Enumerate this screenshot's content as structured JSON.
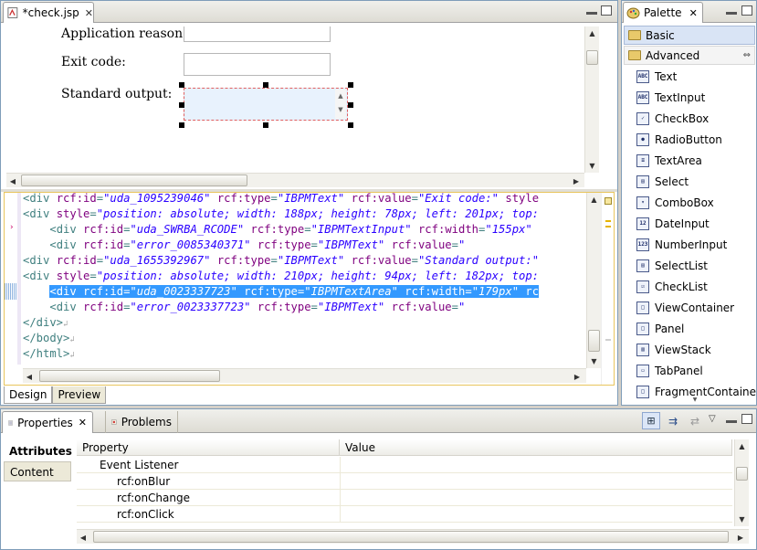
{
  "editor": {
    "tab_title": "*check.jsp",
    "design_form": {
      "labels": [
        "Application reason:",
        "Exit code:",
        "Standard output:"
      ]
    },
    "source_lines": [
      {
        "indent": "",
        "parts": [
          [
            "tag",
            "<div "
          ],
          [
            "attr",
            "rcf:id"
          ],
          [
            "tag",
            "="
          ],
          [
            "val",
            "\"uda_1095239046\""
          ],
          [
            "tag",
            " "
          ],
          [
            "attr",
            "rcf:type"
          ],
          [
            "tag",
            "="
          ],
          [
            "val",
            "\"IBPMText\""
          ],
          [
            "tag",
            " "
          ],
          [
            "attr",
            "rcf:value"
          ],
          [
            "tag",
            "="
          ],
          [
            "val",
            "\"Exit code:\""
          ],
          [
            "tag",
            " "
          ],
          [
            "attr",
            "style"
          ]
        ]
      },
      {
        "indent": "",
        "parts": [
          [
            "tag",
            "<div "
          ],
          [
            "attr",
            "style"
          ],
          [
            "tag",
            "="
          ],
          [
            "val",
            "\"position: absolute; width: 188px; height: 78px; left: 201px; top:"
          ]
        ]
      },
      {
        "indent": "    ",
        "parts": [
          [
            "tag",
            "<div "
          ],
          [
            "attr",
            "rcf:id"
          ],
          [
            "tag",
            "="
          ],
          [
            "val",
            "\"uda_SWRBA_RCODE\""
          ],
          [
            "tag",
            " "
          ],
          [
            "attr",
            "rcf:type"
          ],
          [
            "tag",
            "="
          ],
          [
            "val",
            "\"IBPMTextInput\""
          ],
          [
            "tag",
            " "
          ],
          [
            "attr",
            "rcf:width"
          ],
          [
            "tag",
            "="
          ],
          [
            "val",
            "\"155px\""
          ]
        ]
      },
      {
        "indent": "    ",
        "parts": [
          [
            "tag",
            "<div "
          ],
          [
            "attr",
            "rcf:id"
          ],
          [
            "tag",
            "="
          ],
          [
            "val",
            "\"error_0085340371\""
          ],
          [
            "tag",
            " "
          ],
          [
            "attr",
            "rcf:type"
          ],
          [
            "tag",
            "="
          ],
          [
            "val",
            "\"IBPMText\""
          ],
          [
            "tag",
            " "
          ],
          [
            "attr",
            "rcf:value"
          ],
          [
            "tag",
            "="
          ],
          [
            "val",
            "\""
          ]
        ]
      },
      {
        "indent": "",
        "parts": [
          [
            "tag",
            "<div "
          ],
          [
            "attr",
            "rcf:id"
          ],
          [
            "tag",
            "="
          ],
          [
            "val",
            "\"uda_1655392967\""
          ],
          [
            "tag",
            " "
          ],
          [
            "attr",
            "rcf:type"
          ],
          [
            "tag",
            "="
          ],
          [
            "val",
            "\"IBPMText\""
          ],
          [
            "tag",
            " "
          ],
          [
            "attr",
            "rcf:value"
          ],
          [
            "tag",
            "="
          ],
          [
            "val",
            "\"Standard output:\""
          ]
        ]
      },
      {
        "indent": "",
        "parts": [
          [
            "tag",
            "<div "
          ],
          [
            "attr",
            "style"
          ],
          [
            "tag",
            "="
          ],
          [
            "val",
            "\"position: absolute; width: 210px; height: 94px; left: 182px; top:"
          ]
        ]
      },
      {
        "indent": "    ",
        "highlight": true,
        "parts": [
          [
            "tag",
            "<div "
          ],
          [
            "attr",
            "rcf:id"
          ],
          [
            "tag",
            "="
          ],
          [
            "val",
            "\"uda_0023337723\""
          ],
          [
            "tag",
            " "
          ],
          [
            "attr",
            "rcf:type"
          ],
          [
            "tag",
            "="
          ],
          [
            "val",
            "\"IBPMTextArea\""
          ],
          [
            "tag",
            " "
          ],
          [
            "attr",
            "rcf:width"
          ],
          [
            "tag",
            "="
          ],
          [
            "val",
            "\"179px\""
          ],
          [
            "tag",
            " rc"
          ]
        ]
      },
      {
        "indent": "    ",
        "parts": [
          [
            "tag",
            "<div "
          ],
          [
            "attr",
            "rcf:id"
          ],
          [
            "tag",
            "="
          ],
          [
            "val",
            "\"error_0023337723\""
          ],
          [
            "tag",
            " "
          ],
          [
            "attr",
            "rcf:type"
          ],
          [
            "tag",
            "="
          ],
          [
            "val",
            "\"IBPMText\""
          ],
          [
            "tag",
            " "
          ],
          [
            "attr",
            "rcf:value"
          ],
          [
            "tag",
            "="
          ],
          [
            "val",
            "\""
          ]
        ]
      },
      {
        "indent": "",
        "parts": [
          [
            "tag",
            "</div>"
          ]
        ]
      },
      {
        "indent": "",
        "parts": [
          [
            "tag",
            "</body>"
          ]
        ]
      },
      {
        "indent": "",
        "parts": [
          [
            "tag",
            "</html>"
          ]
        ]
      }
    ],
    "bottom_tabs": [
      "Design",
      "Preview"
    ]
  },
  "palette": {
    "title": "Palette",
    "groups": [
      "Basic",
      "Advanced"
    ],
    "items": [
      {
        "label": "Text",
        "icon": "ABC"
      },
      {
        "label": "TextInput",
        "icon": "ABC"
      },
      {
        "label": "CheckBox",
        "icon": "✓"
      },
      {
        "label": "RadioButton",
        "icon": "●"
      },
      {
        "label": "TextArea",
        "icon": "≡"
      },
      {
        "label": "Select",
        "icon": "▤"
      },
      {
        "label": "ComboBox",
        "icon": "▾"
      },
      {
        "label": "DateInput",
        "icon": "12"
      },
      {
        "label": "NumberInput",
        "icon": "123"
      },
      {
        "label": "SelectList",
        "icon": "▤"
      },
      {
        "label": "CheckList",
        "icon": "☑"
      },
      {
        "label": "ViewContainer",
        "icon": "□"
      },
      {
        "label": "Panel",
        "icon": "□"
      },
      {
        "label": "ViewStack",
        "icon": "▥"
      },
      {
        "label": "TabPanel",
        "icon": "▭"
      },
      {
        "label": "FragmentContainer",
        "icon": "□"
      }
    ]
  },
  "properties": {
    "tabs": [
      "Properties",
      "Problems"
    ],
    "side_tabs": [
      "Attributes",
      "Content"
    ],
    "columns": [
      "Property",
      "Value"
    ],
    "rows": [
      {
        "label": "Event Listener",
        "level": 1
      },
      {
        "label": "rcf:onBlur",
        "level": 2
      },
      {
        "label": "rcf:onChange",
        "level": 2
      },
      {
        "label": "rcf:onClick",
        "level": 2
      }
    ]
  }
}
